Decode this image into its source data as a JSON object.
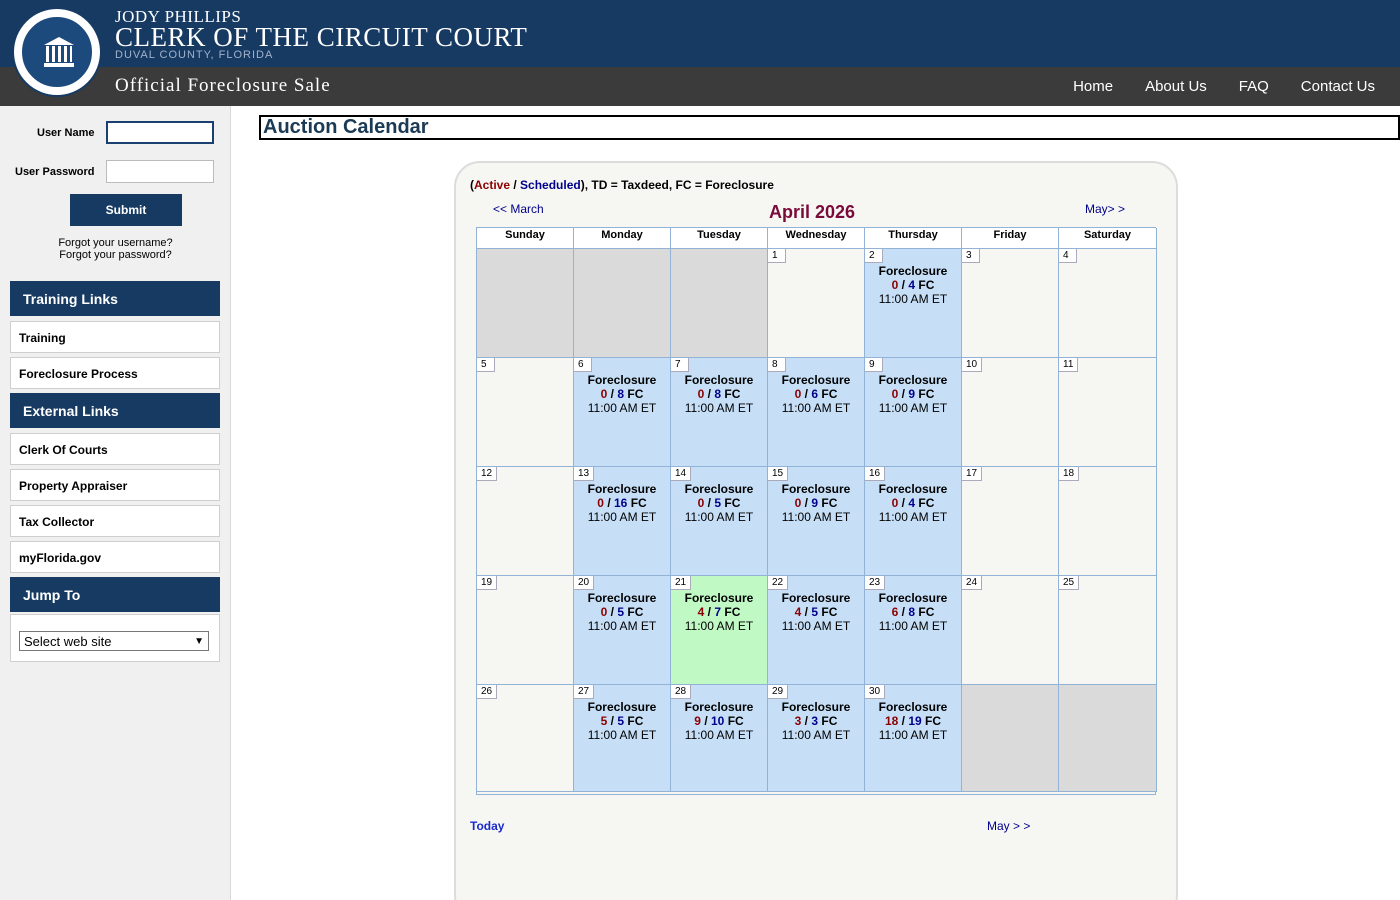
{
  "header": {
    "clerk_name": "JODY PHILLIPS",
    "clerk_title": "CLERK OF THE CIRCUIT COURT",
    "county": "DUVAL COUNTY, FLORIDA",
    "site_title": "Official Foreclosure Sale",
    "nav": [
      "Home",
      "About Us",
      "FAQ",
      "Contact Us"
    ]
  },
  "colors": {
    "brand": "#173a63",
    "active": "#8b0000",
    "scheduled": "#00008b",
    "auction_day": "#c6dff7",
    "today_day": "#c1f9c5",
    "blank_day": "#dadada"
  },
  "login": {
    "username_label": "User Name",
    "username_value": "",
    "password_label": "User Password",
    "password_value": "",
    "submit_label": "Submit",
    "forgot_username": "Forgot your username?",
    "forgot_password": "Forgot your password?"
  },
  "sidebar": {
    "training_header": "Training Links",
    "training_links": [
      "Training",
      "Foreclosure Process"
    ],
    "external_header": "External Links",
    "external_links": [
      "Clerk Of Courts",
      "Property Appraiser",
      "Tax Collector",
      "myFlorida.gov"
    ],
    "jump_header": "Jump To",
    "jump_selected": "Select web site"
  },
  "main": {
    "page_title": "Auction Calendar",
    "legend": {
      "open": "(",
      "active": "Active",
      "sep": " / ",
      "scheduled": "Scheduled",
      "rest": "), TD = Taxdeed, FC = Foreclosure"
    },
    "prev_link": "<< March",
    "next_link": "May> >",
    "month": "April 2026",
    "today_link": "Today",
    "bottom_next_link": "May > >"
  },
  "calendar": {
    "weekdays": [
      "Sunday",
      "Monday",
      "Tuesday",
      "Wednesday",
      "Thursday",
      "Friday",
      "Saturday"
    ],
    "cells": [
      {
        "day": "",
        "status": "blank"
      },
      {
        "day": "",
        "status": "blank"
      },
      {
        "day": "",
        "status": "blank"
      },
      {
        "day": "1",
        "status": "normal"
      },
      {
        "day": "2",
        "status": "auction",
        "type": "Foreclosure",
        "active": "0",
        "scheduled": "4",
        "code": "FC",
        "time": "11:00 AM ET"
      },
      {
        "day": "3",
        "status": "normal"
      },
      {
        "day": "4",
        "status": "normal"
      },
      {
        "day": "5",
        "status": "normal"
      },
      {
        "day": "6",
        "status": "auction",
        "type": "Foreclosure",
        "active": "0",
        "scheduled": "8",
        "code": "FC",
        "time": "11:00 AM ET"
      },
      {
        "day": "7",
        "status": "auction",
        "type": "Foreclosure",
        "active": "0",
        "scheduled": "8",
        "code": "FC",
        "time": "11:00 AM ET"
      },
      {
        "day": "8",
        "status": "auction",
        "type": "Foreclosure",
        "active": "0",
        "scheduled": "6",
        "code": "FC",
        "time": "11:00 AM ET"
      },
      {
        "day": "9",
        "status": "auction",
        "type": "Foreclosure",
        "active": "0",
        "scheduled": "9",
        "code": "FC",
        "time": "11:00 AM ET"
      },
      {
        "day": "10",
        "status": "normal"
      },
      {
        "day": "11",
        "status": "normal"
      },
      {
        "day": "12",
        "status": "normal"
      },
      {
        "day": "13",
        "status": "auction",
        "type": "Foreclosure",
        "active": "0",
        "scheduled": "16",
        "code": "FC",
        "time": "11:00 AM ET"
      },
      {
        "day": "14",
        "status": "auction",
        "type": "Foreclosure",
        "active": "0",
        "scheduled": "5",
        "code": "FC",
        "time": "11:00 AM ET"
      },
      {
        "day": "15",
        "status": "auction",
        "type": "Foreclosure",
        "active": "0",
        "scheduled": "9",
        "code": "FC",
        "time": "11:00 AM ET"
      },
      {
        "day": "16",
        "status": "auction",
        "type": "Foreclosure",
        "active": "0",
        "scheduled": "4",
        "code": "FC",
        "time": "11:00 AM ET"
      },
      {
        "day": "17",
        "status": "normal"
      },
      {
        "day": "18",
        "status": "normal"
      },
      {
        "day": "19",
        "status": "normal"
      },
      {
        "day": "20",
        "status": "auction",
        "type": "Foreclosure",
        "active": "0",
        "scheduled": "5",
        "code": "FC",
        "time": "11:00 AM ET"
      },
      {
        "day": "21",
        "status": "today",
        "type": "Foreclosure",
        "active": "4",
        "scheduled": "7",
        "code": "FC",
        "time": "11:00 AM ET"
      },
      {
        "day": "22",
        "status": "auction",
        "type": "Foreclosure",
        "active": "4",
        "scheduled": "5",
        "code": "FC",
        "time": "11:00 AM ET"
      },
      {
        "day": "23",
        "status": "auction",
        "type": "Foreclosure",
        "active": "6",
        "scheduled": "8",
        "code": "FC",
        "time": "11:00 AM ET"
      },
      {
        "day": "24",
        "status": "normal"
      },
      {
        "day": "25",
        "status": "normal"
      },
      {
        "day": "26",
        "status": "normal"
      },
      {
        "day": "27",
        "status": "auction",
        "type": "Foreclosure",
        "active": "5",
        "scheduled": "5",
        "code": "FC",
        "time": "11:00 AM ET"
      },
      {
        "day": "28",
        "status": "auction",
        "type": "Foreclosure",
        "active": "9",
        "scheduled": "10",
        "code": "FC",
        "time": "11:00 AM ET"
      },
      {
        "day": "29",
        "status": "auction",
        "type": "Foreclosure",
        "active": "3",
        "scheduled": "3",
        "code": "FC",
        "time": "11:00 AM ET"
      },
      {
        "day": "30",
        "status": "auction",
        "type": "Foreclosure",
        "active": "18",
        "scheduled": "19",
        "code": "FC",
        "time": "11:00 AM ET"
      },
      {
        "day": "",
        "status": "blank"
      },
      {
        "day": "",
        "status": "blank"
      }
    ]
  }
}
